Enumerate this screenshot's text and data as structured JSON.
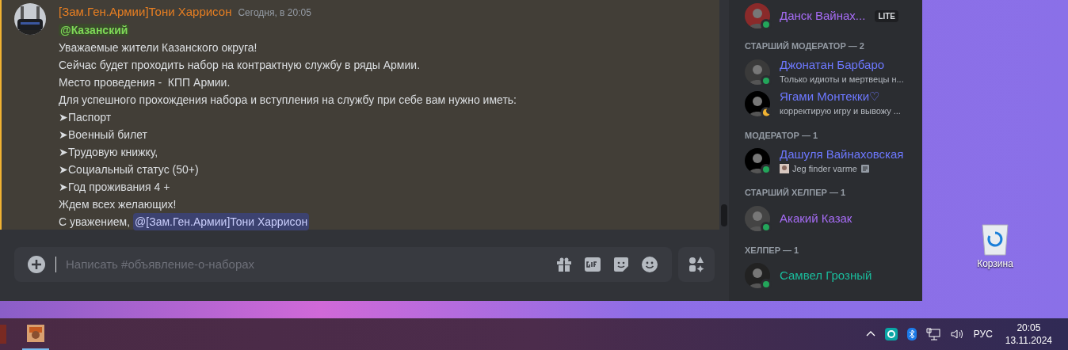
{
  "message": {
    "author": "[Зам.Ген.Армии]Тони Харрисон",
    "timestamp": "Сегодня, в 20:05",
    "mention": "@Казанский",
    "lines": [
      "Уважаемые жители Казанского округа!",
      "Сейчас будет проходить набор на контрактную службу в ряды Армии.",
      "Место проведения -  КПП Армии.",
      "Для успешного прохождения набора и вступления на службу при себе вам нужно иметь:",
      "➤Паспорт",
      "➤Военный билет",
      "➤Трудовую книжку,",
      "➤Социальный статус (50+)",
      "➤Год проживания 4 +",
      "Ждем всех желающих!"
    ],
    "signoff": "С уважением,",
    "signoff_mention": "@[Зам.Ген.Армии]Тони Харрисон"
  },
  "composer": {
    "placeholder": "Написать #объявление-о-наборах"
  },
  "member_list": {
    "top_member": {
      "name": "Данск Вайнах...",
      "badge": "LITE",
      "color": "#a66cf5",
      "idle": false
    },
    "groups": [
      {
        "title": "СТАРШИЙ МОДЕРАТОР — 2",
        "members": [
          {
            "name": "Джонатан Барбаро",
            "status_text": "Только идиоты и мертвецы н...",
            "color": "#6d78ff",
            "idle": false
          },
          {
            "name": "Ягами Монтекки♡",
            "status_text": "корректирую игру и вывожу ...",
            "color": "#6d78ff",
            "idle": true
          }
        ]
      },
      {
        "title": "МОДЕРАТОР — 1",
        "members": [
          {
            "name": "Дашуля Вайнаховская",
            "status_text": "Jeg finder varme",
            "color": "#6d78ff",
            "idle": false
          }
        ]
      },
      {
        "title": "СТАРШИЙ ХЕЛПЕР — 1",
        "members": [
          {
            "name": "Акакий Казак",
            "color": "#a66cf5",
            "idle": false
          }
        ]
      },
      {
        "title": "ХЕЛПЕР — 1",
        "members": [
          {
            "name": "Самвел Грозный",
            "color": "#1abc9c",
            "idle": false
          }
        ]
      }
    ]
  },
  "desktop": {
    "icons": [
      {
        "label": "Корзина"
      }
    ]
  },
  "taskbar": {
    "language": "РУС",
    "time": "20:05",
    "date": "13.11.2024"
  }
}
